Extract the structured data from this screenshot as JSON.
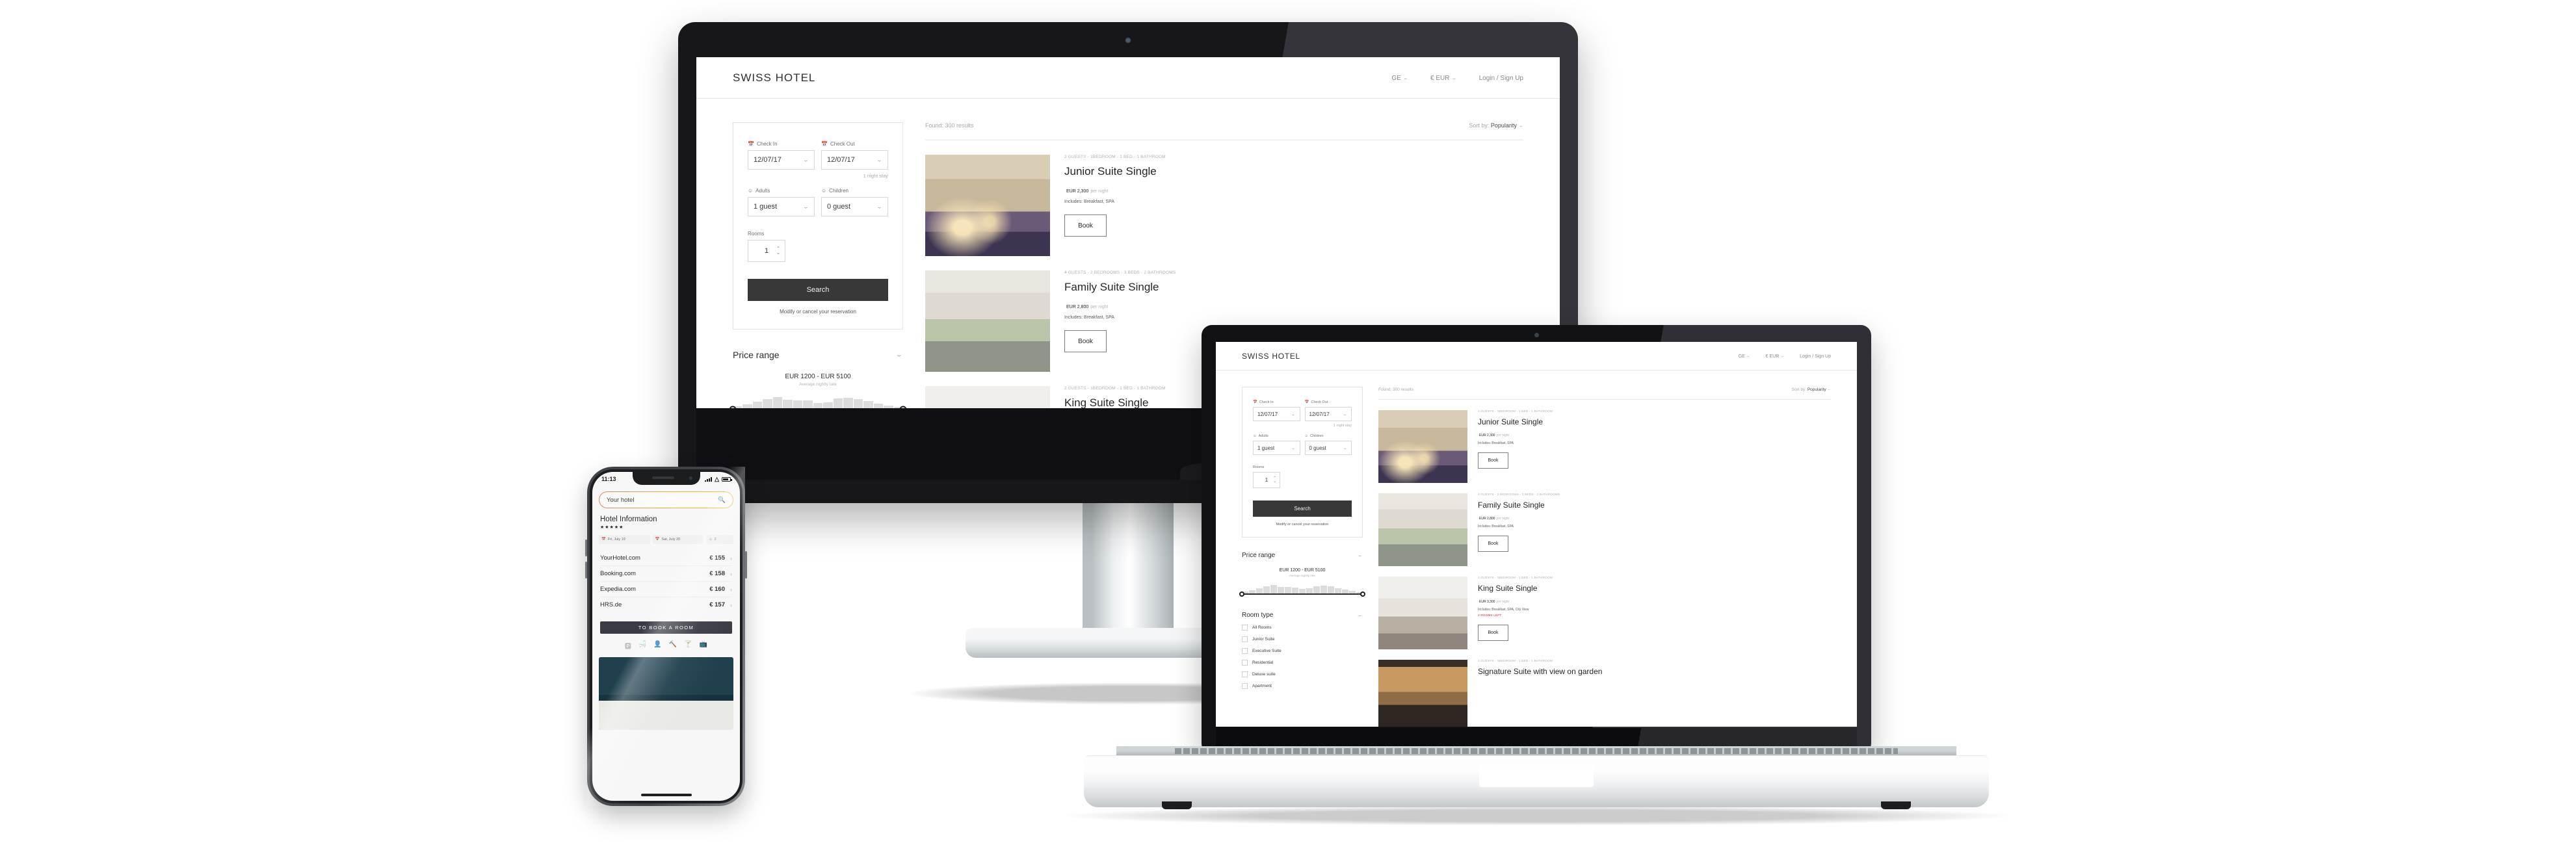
{
  "site": {
    "logo": "SWISS HOTEL",
    "nav": [
      {
        "label": "GE",
        "caret": "⌄",
        "name": "language-selector"
      },
      {
        "label": "€ EUR",
        "caret": "⌄",
        "name": "currency-selector"
      },
      {
        "label": "Login / Sign Up",
        "caret": "",
        "name": "login-signup-link"
      }
    ],
    "search_panel": {
      "checkin_label": "Check In",
      "checkin_value": "12/07/17",
      "checkout_label": "Check Out",
      "checkout_value": "12/07/17",
      "nights_note": "1 night stay",
      "adults_label": "Adults",
      "adults_value": "1 guest",
      "children_label": "Children",
      "children_value": "0 guest",
      "rooms_label": "Rooms",
      "rooms_value": "1",
      "search_button": "Search",
      "modify_link": "Modify or cancel your reservation"
    },
    "price_filter": {
      "title": "Price range",
      "range_text": "EUR 1200 - EUR 5100",
      "subtitle": "Average nightly rate",
      "min": 1200,
      "max": 5100
    },
    "room_type_filter": {
      "title": "Room type",
      "options": [
        "All Rooms",
        "Junior Suite",
        "Executive Suite",
        "Residential",
        "Deluxe suite",
        "Apartment"
      ]
    },
    "results_header": {
      "found": "Found: 300 results",
      "sort_prefix": "Sort by:",
      "sort_value": "Popularity",
      "caret": "⌄"
    },
    "book_button": "Book",
    "per_night": "per night",
    "results": [
      {
        "meta": "2 GUESTS - 1BEDROOM - 1 BED - 1 BATHROOM",
        "name": "Junior Suite Single",
        "price": "EUR 2,300",
        "includes": "Includes: Breakfast, SPA",
        "rooms_left": "",
        "photo": "ph-junior"
      },
      {
        "meta": "4 GUESTS - 2 BEDROOMS - 3 BEDS - 2 BATHROOMS",
        "name": "Family Suite Single",
        "price": "EUR 2,800",
        "includes": "Includes: Breakfast, SPA",
        "rooms_left": "",
        "photo": "ph-family"
      },
      {
        "meta": "2 GUESTS - 1BEDROOM - 1 BED - 1 BATHROOM",
        "name": "King Suite Single",
        "price": "EUR 3,300",
        "includes": "Includes: Breakfast, SPA, City View",
        "rooms_left": "2 ROOMS LEFT",
        "photo": "ph-king"
      },
      {
        "meta": "2 GUESTS - 1BEDROOM - 1 BED - 1 BATHROOM",
        "name": "Signature Suite with view on garden",
        "price": "",
        "includes": "",
        "rooms_left": "",
        "photo": "ph-sig"
      }
    ]
  },
  "phone": {
    "status": {
      "time": "11:13"
    },
    "search": {
      "value": "Your hotel",
      "placeholder": "Your hotel",
      "icon": "search-icon"
    },
    "heading": "Hotel Information",
    "stars": "★★★★★",
    "chips": [
      {
        "icon": "calendar-icon",
        "label": "Fri, July 19"
      },
      {
        "icon": "calendar-icon",
        "label": "Sat, July 20"
      },
      {
        "icon": "person-icon",
        "label": "2"
      }
    ],
    "providers": [
      {
        "name": "YourHotel.com",
        "price": "€ 155",
        "chevron": "›"
      },
      {
        "name": "Booking.com",
        "price": "€ 158",
        "chevron": "›"
      },
      {
        "name": "Expedia.com",
        "price": "€ 160",
        "chevron": "›"
      },
      {
        "name": "HRS.de",
        "price": "€ 157",
        "chevron": "›"
      }
    ],
    "cta": "TO BOOK A ROOM",
    "amenities": [
      "parking-icon",
      "bathtub-icon",
      "concierge-icon",
      "cleaning-icon",
      "bar-icon",
      "tv-icon"
    ]
  },
  "colors": {
    "accent_dark": "#383838",
    "alert_red": "#d0202a",
    "bezel_dark": "#17171a",
    "phone_search_gradient_start": "#e8855c",
    "phone_search_gradient_end": "#f3c34b"
  }
}
